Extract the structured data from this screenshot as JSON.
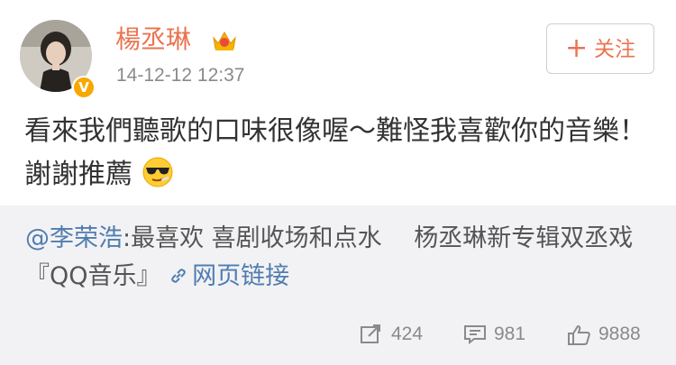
{
  "post": {
    "username": "楊丞琳",
    "timestamp": "14-12-12 12:37",
    "follow_label": "关注",
    "follow_plus": "+",
    "verified_badge": "V",
    "content_text": "看來我們聽歌的口味很像喔～難怪我喜歡你的音樂！謝謝推薦",
    "content_emoji": "cool-sunglasses-emoji"
  },
  "repost": {
    "mention": "@李荣浩",
    "text": ":最喜欢 喜剧收场和点水　 杨丞琳新专辑双丞戏『QQ音乐』",
    "link_label": "网页链接"
  },
  "actions": {
    "repost_count": "424",
    "comment_count": "981",
    "like_count": "9888"
  },
  "colors": {
    "accent": "#eb7350",
    "link": "#507daf",
    "repost_bg": "#f2f2f5",
    "badge": "#f7a800"
  }
}
